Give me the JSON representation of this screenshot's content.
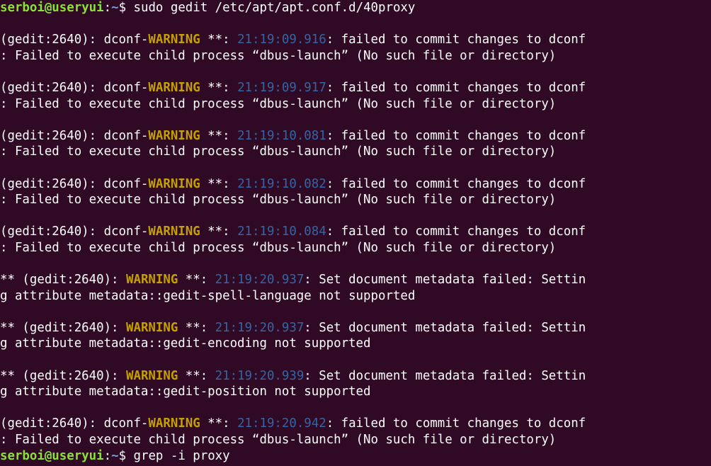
{
  "colors": {
    "background": "#300a24",
    "prompt_user": "#8ae234",
    "prompt_path": "#729fcf",
    "warning": "#c4a000",
    "timestamp": "#3465a4",
    "text": "#ffffff"
  },
  "prompt": {
    "user_host": "serboi@useryui",
    "colon": ":",
    "path": "~",
    "symbol": "$ "
  },
  "commands": {
    "first": "sudo gedit /etc/apt/apt.conf.d/40proxy",
    "last": "grep -i proxy"
  },
  "entries": [
    {
      "prefix": "(gedit:2640): dconf-",
      "level": "WARNING",
      "sep": " **: ",
      "time": "21:19:09.916",
      "msg": ": failed to commit changes to dconf",
      "cont": ": Failed to execute child process “dbus-launch” (No such file or directory)"
    },
    {
      "prefix": "(gedit:2640): dconf-",
      "level": "WARNING",
      "sep": " **: ",
      "time": "21:19:09.917",
      "msg": ": failed to commit changes to dconf",
      "cont": ": Failed to execute child process “dbus-launch” (No such file or directory)"
    },
    {
      "prefix": "(gedit:2640): dconf-",
      "level": "WARNING",
      "sep": " **: ",
      "time": "21:19:10.081",
      "msg": ": failed to commit changes to dconf",
      "cont": ": Failed to execute child process “dbus-launch” (No such file or directory)"
    },
    {
      "prefix": "(gedit:2640): dconf-",
      "level": "WARNING",
      "sep": " **: ",
      "time": "21:19:10.082",
      "msg": ": failed to commit changes to dconf",
      "cont": ": Failed to execute child process “dbus-launch” (No such file or directory)"
    },
    {
      "prefix": "(gedit:2640): dconf-",
      "level": "WARNING",
      "sep": " **: ",
      "time": "21:19:10.084",
      "msg": ": failed to commit changes to dconf",
      "cont": ": Failed to execute child process “dbus-launch” (No such file or directory)"
    },
    {
      "prefix": "** (gedit:2640): ",
      "level": "WARNING",
      "sep": " **: ",
      "time": "21:19:20.937",
      "msg": ": Set document metadata failed: Settin",
      "cont": "g attribute metadata::gedit-spell-language not supported"
    },
    {
      "prefix": "** (gedit:2640): ",
      "level": "WARNING",
      "sep": " **: ",
      "time": "21:19:20.937",
      "msg": ": Set document metadata failed: Settin",
      "cont": "g attribute metadata::gedit-encoding not supported"
    },
    {
      "prefix": "** (gedit:2640): ",
      "level": "WARNING",
      "sep": " **: ",
      "time": "21:19:20.939",
      "msg": ": Set document metadata failed: Settin",
      "cont": "g attribute metadata::gedit-position not supported"
    },
    {
      "prefix": "(gedit:2640): dconf-",
      "level": "WARNING",
      "sep": " **: ",
      "time": "21:19:20.942",
      "msg": ": failed to commit changes to dconf",
      "cont": ": Failed to execute child process “dbus-launch” (No such file or directory)"
    }
  ]
}
